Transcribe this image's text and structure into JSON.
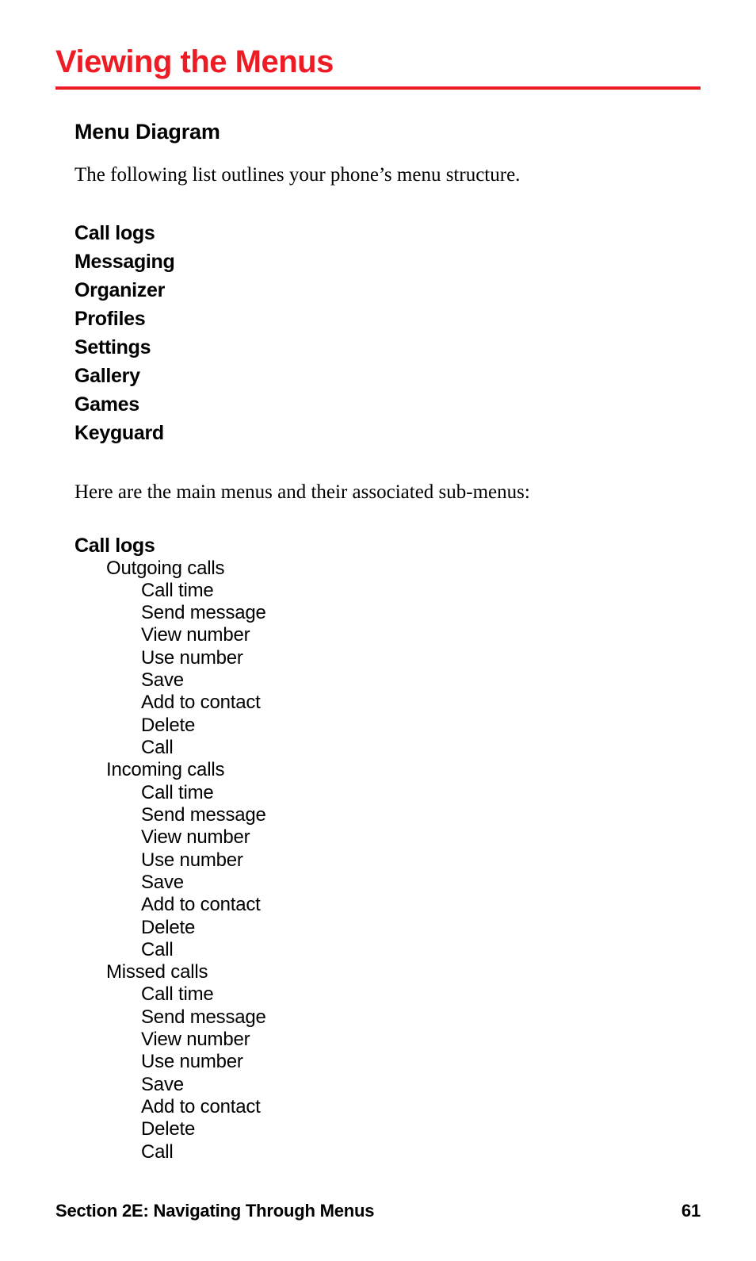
{
  "accent_color": "#ED1C24",
  "title": "Viewing the Menus",
  "subhead": "Menu Diagram",
  "intro": "The following list outlines your phone’s menu structure.",
  "top_menus": [
    "Call logs",
    "Messaging",
    "Organizer",
    "Profiles",
    "Settings",
    "Gallery",
    "Games",
    "Keyguard"
  ],
  "sub_intro": "Here are the main menus and their associated sub-menus:",
  "menu_tree": {
    "head": "Call logs",
    "groups": [
      {
        "name": "Outgoing calls",
        "items": [
          "Call time",
          "Send message",
          "View number",
          "Use number",
          "Save",
          "Add to contact",
          "Delete",
          "Call"
        ]
      },
      {
        "name": "Incoming calls",
        "items": [
          "Call time",
          "Send message",
          "View number",
          "Use number",
          "Save",
          "Add to contact",
          "Delete",
          "Call"
        ]
      },
      {
        "name": "Missed calls",
        "items": [
          "Call time",
          "Send message",
          "View number",
          "Use number",
          "Save",
          "Add to contact",
          "Delete",
          "Call"
        ]
      }
    ]
  },
  "footer": {
    "section": "Section 2E: Navigating Through Menus",
    "page": "61"
  }
}
